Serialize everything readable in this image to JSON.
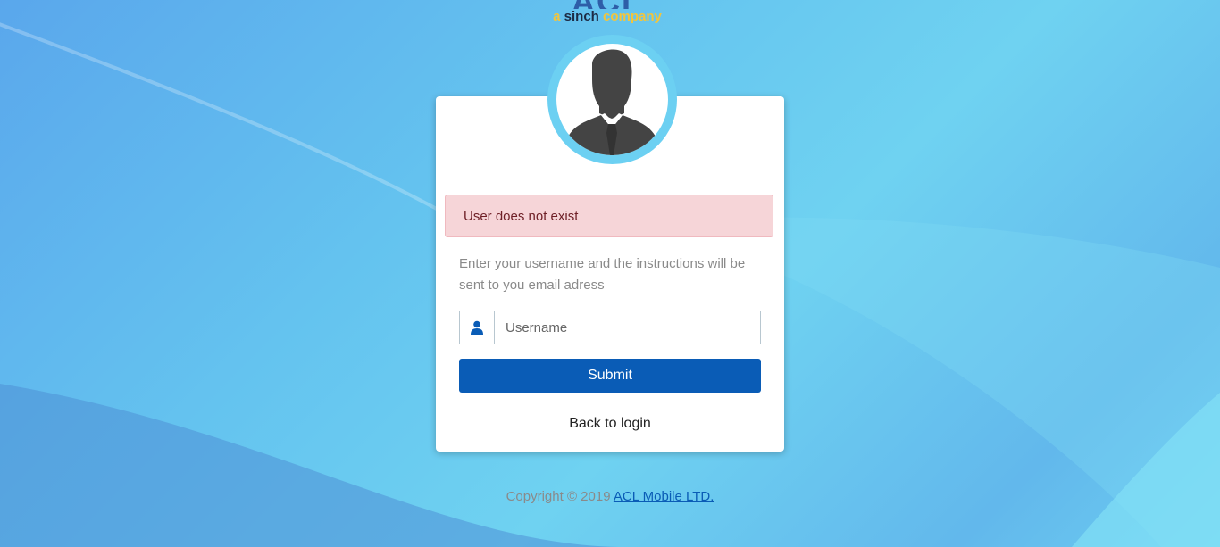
{
  "logo": {
    "mark": "ACL",
    "sub_prefix": "a ",
    "sub_brand": "sinch",
    "sub_suffix": " company"
  },
  "alert": {
    "message": "User does not exist"
  },
  "form": {
    "instructions": "Enter your username and the instructions will be sent to you email adress",
    "username_placeholder": "Username",
    "username_icon": "user-icon",
    "submit_label": "Submit",
    "back_label": "Back to login"
  },
  "footer": {
    "copyright": "Copyright © 2019 ",
    "company_link": "ACL Mobile LTD."
  },
  "colors": {
    "accent": "#0a5cb6",
    "ring": "#6cd0f2",
    "alert_bg": "#f6d5d8",
    "logo_yellow": "#f2c53d"
  }
}
